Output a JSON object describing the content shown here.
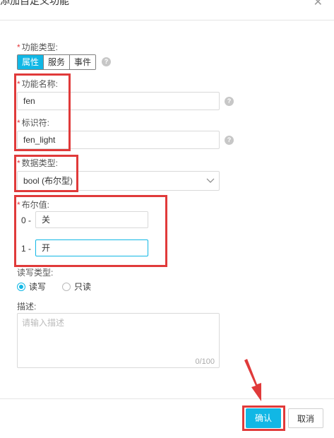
{
  "dialog": {
    "title": "添加自定义功能",
    "close_icon": "close-icon"
  },
  "form": {
    "type_label": "功能类型:",
    "type_tabs": [
      {
        "label": "属性",
        "active": true
      },
      {
        "label": "服务",
        "active": false
      },
      {
        "label": "事件",
        "active": false
      }
    ],
    "name_label": "功能名称:",
    "name_value": "fen",
    "identifier_label": "标识符:",
    "identifier_value": "fen_light",
    "datatype_label": "数据类型:",
    "datatype_value": "bool (布尔型)",
    "bool_label": "布尔值:",
    "bool_rows": [
      {
        "prefix": "0 -",
        "value": "关"
      },
      {
        "prefix": "1 -",
        "value": "开"
      }
    ],
    "rw_label": "读写类型:",
    "rw_options": [
      {
        "label": "读写",
        "checked": true
      },
      {
        "label": "只读",
        "checked": false
      }
    ],
    "desc_label": "描述:",
    "desc_placeholder": "请输入描述",
    "desc_counter": "0/100",
    "required_mark": "*",
    "help_glyph": "?"
  },
  "footer": {
    "confirm_label": "确认",
    "cancel_label": "取消"
  },
  "colors": {
    "accent": "#11b7e5",
    "annotation_red": "#e03a3a"
  }
}
